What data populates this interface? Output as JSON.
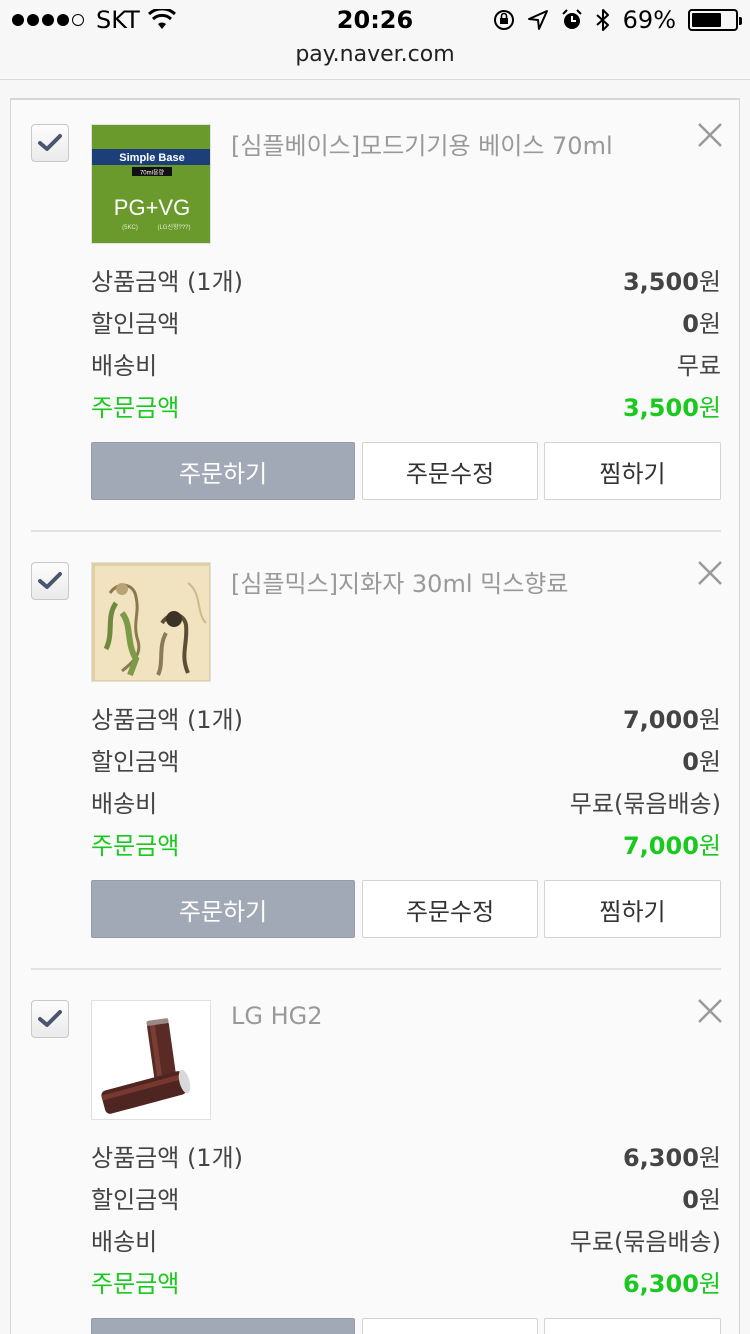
{
  "status_bar": {
    "carrier": "SKT",
    "time": "20:26",
    "battery_pct": "69%",
    "battery_level": 0.69
  },
  "address_bar": {
    "url": "pay.naver.com"
  },
  "items": [
    {
      "title": "[심플베이스]모드기기용 베이스 70ml",
      "checked": true,
      "price_label": "상품금액 (1개)",
      "price_value": "3,500",
      "discount_label": "할인금액",
      "discount_value": "0",
      "shipping_label": "배송비",
      "shipping_value": "무료",
      "total_label": "주문금액",
      "total_value": "3,500",
      "currency": "원",
      "buttons": {
        "order": "주문하기",
        "edit": "주문수정",
        "wish": "찜하기"
      },
      "thumb": {
        "top_text": "Simple Base",
        "mid_text": "70ml용량",
        "big_text": "PG+VG",
        "small_left": "(5KC)",
        "small_right": "(LG신향???)"
      }
    },
    {
      "title": "[심플믹스]지화자 30ml 믹스향료",
      "checked": true,
      "price_label": "상품금액 (1개)",
      "price_value": "7,000",
      "discount_label": "할인금액",
      "discount_value": "0",
      "shipping_label": "배송비",
      "shipping_value": "무료(묶음배송)",
      "total_label": "주문금액",
      "total_value": "7,000",
      "currency": "원",
      "buttons": {
        "order": "주문하기",
        "edit": "주문수정",
        "wish": "찜하기"
      }
    },
    {
      "title": "LG HG2",
      "checked": true,
      "price_label": "상품금액 (1개)",
      "price_value": "6,300",
      "discount_label": "할인금액",
      "discount_value": "0",
      "shipping_label": "배송비",
      "shipping_value": "무료(묶음배송)",
      "total_label": "주문금액",
      "total_value": "6,300",
      "currency": "원",
      "buttons": {
        "order": "주문하기",
        "edit": "주문수정",
        "wish": "찜하기"
      }
    }
  ],
  "colors": {
    "total_green": "#19c91e",
    "order_button": "#a2a9b6",
    "muted_title": "#999999"
  }
}
